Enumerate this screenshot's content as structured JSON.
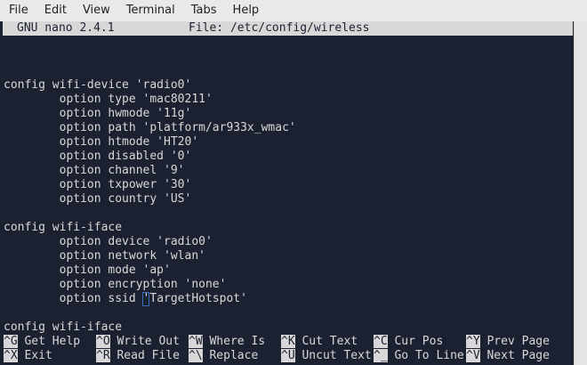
{
  "menubar": {
    "items": [
      "File",
      "Edit",
      "View",
      "Terminal",
      "Tabs",
      "Help"
    ]
  },
  "nano": {
    "version": "GNU nano 2.4.1",
    "file_label": "File: /etc/config/wireless"
  },
  "editor": {
    "lines": [
      "",
      "config wifi-device 'radio0'",
      "        option type 'mac80211'",
      "        option hwmode '11g'",
      "        option path 'platform/ar933x_wmac'",
      "        option htmode 'HT20'",
      "        option disabled '0'",
      "        option channel '9'",
      "        option txpower '30'",
      "        option country 'US'",
      "",
      "config wifi-iface",
      "        option device 'radio0'",
      "        option network 'wlan'",
      "        option mode 'ap'",
      "        option encryption 'none'",
      "        option ssid 'TargetHotspot'",
      "",
      "config wifi-iface"
    ],
    "cursor_line": 16,
    "cursor_col": 20
  },
  "shortcuts": {
    "row1": [
      {
        "key": "^G",
        "label": "Get Help"
      },
      {
        "key": "^O",
        "label": "Write Out"
      },
      {
        "key": "^W",
        "label": "Where Is"
      },
      {
        "key": "^K",
        "label": "Cut Text"
      },
      {
        "key": "^C",
        "label": "Cur Pos"
      },
      {
        "key": "^Y",
        "label": "Prev Page"
      }
    ],
    "row2": [
      {
        "key": "^X",
        "label": "Exit"
      },
      {
        "key": "^R",
        "label": "Read File"
      },
      {
        "key": "^\\",
        "label": "Replace"
      },
      {
        "key": "^U",
        "label": "Uncut Text"
      },
      {
        "key": "^_",
        "label": "Go To Line"
      },
      {
        "key": "^V",
        "label": "Next Page"
      }
    ]
  }
}
